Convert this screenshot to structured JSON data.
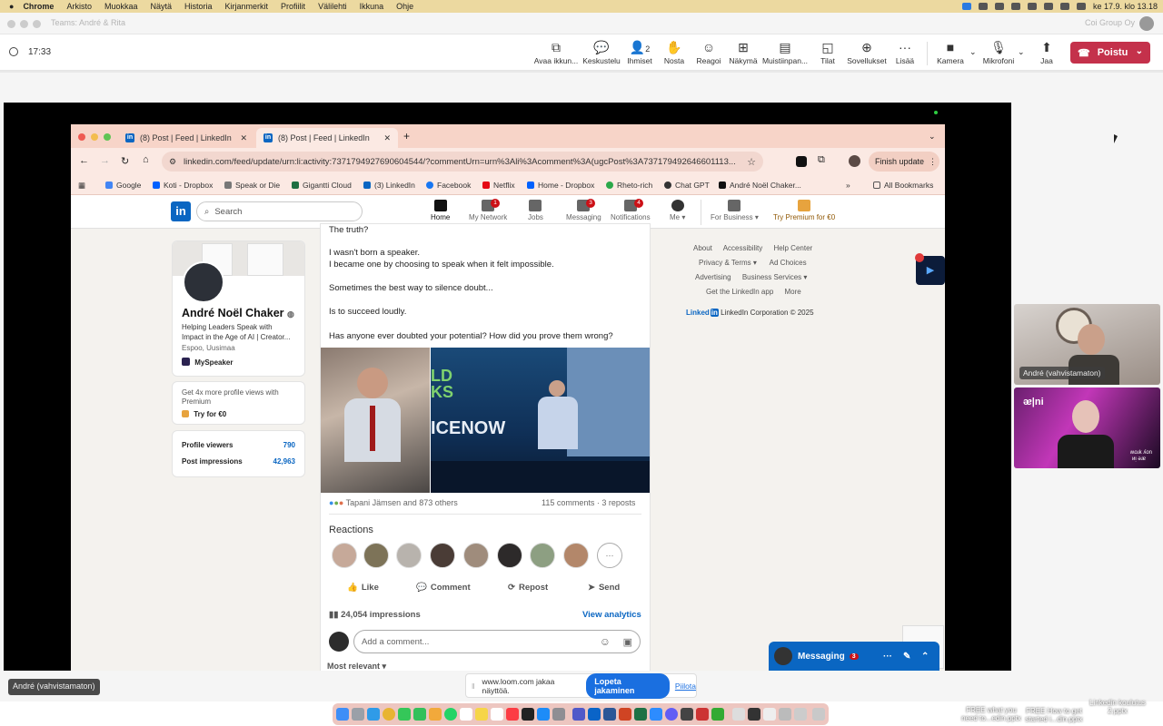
{
  "menubar": {
    "app": "Chrome",
    "items": [
      "Arkisto",
      "Muokkaa",
      "Näytä",
      "Historia",
      "Kirjanmerkit",
      "Profiilit",
      "Välilehti",
      "Ikkuna",
      "Ohje"
    ],
    "clock": "ke 17.9. klo 13.18"
  },
  "teams_title": {
    "left": "Teams: André & Rita",
    "right": "Coi Group Oy"
  },
  "meeting": {
    "timer": "17:33",
    "toolbar": [
      {
        "label": "Avaa ikkun...",
        "icon": "popout-icon"
      },
      {
        "label": "Keskustelu",
        "icon": "chat-icon"
      },
      {
        "label": "Ihmiset",
        "icon": "people-icon",
        "count": "2"
      },
      {
        "label": "Nosta",
        "icon": "raise-hand-icon"
      },
      {
        "label": "Reagoi",
        "icon": "react-icon"
      },
      {
        "label": "Näkymä",
        "icon": "view-icon"
      },
      {
        "label": "Muistiinpan...",
        "icon": "notes-icon"
      },
      {
        "label": "Tilat",
        "icon": "rooms-icon"
      },
      {
        "label": "Sovellukset",
        "icon": "apps-icon"
      },
      {
        "label": "Lisää",
        "icon": "more-icon"
      },
      {
        "label": "Kamera",
        "icon": "camera-icon"
      },
      {
        "label": "Mikrofoni",
        "icon": "mic-icon"
      },
      {
        "label": "Jaa",
        "icon": "share-icon"
      }
    ],
    "leave_label": "Poistu",
    "presenter_label": "André (vahvistamaton)"
  },
  "browser": {
    "tabs": [
      {
        "title": "(8) Post | Feed | LinkedIn",
        "active": false
      },
      {
        "title": "(8) Post | Feed | LinkedIn",
        "active": true
      }
    ],
    "url": "linkedin.com/feed/update/urn:li:activity:7371794927690604544/?commentUrn=urn%3Ali%3Acomment%3A(ugcPost%3A737179492646601113...",
    "finish_update": "Finish update",
    "bookmarks": [
      "Google",
      "Koti - Dropbox",
      "Speak or Die",
      "Gigantti Cloud",
      "(3) LinkedIn",
      "Facebook",
      "Netflix",
      "Home - Dropbox",
      "Rheto-rich",
      "Chat GPT",
      "André Noël Chaker..."
    ],
    "all_bookmarks": "All Bookmarks"
  },
  "linkedin": {
    "search_placeholder": "Search",
    "nav": [
      {
        "label": "Home",
        "badge": ""
      },
      {
        "label": "My Network",
        "badge": "1"
      },
      {
        "label": "Jobs",
        "badge": ""
      },
      {
        "label": "Messaging",
        "badge": "3"
      },
      {
        "label": "Notifications",
        "badge": "4"
      },
      {
        "label": "Me ▾",
        "badge": ""
      },
      {
        "label": "For Business ▾",
        "badge": ""
      },
      {
        "label": "Try Premium for €0",
        "badge": ""
      }
    ],
    "profile": {
      "name": "André Noël Chaker",
      "headline1": "Helping Leaders Speak with",
      "headline2": "Impact in the Age of AI | Creator...",
      "location": "Espoo, Uusimaa",
      "company": "MySpeaker",
      "premium_text1": "Get 4x more profile views with",
      "premium_text2": "Premium",
      "premium_cta": "Try for €0",
      "stats": [
        {
          "label": "Profile viewers",
          "value": "790"
        },
        {
          "label": "Post impressions",
          "value": "42,963"
        }
      ]
    },
    "post": {
      "lines": [
        "The truth?",
        "I wasn't born a speaker.",
        "I became one by choosing to speak when it felt impossible.",
        "Sometimes the best way to silence doubt...",
        "Is to succeed loudly.",
        "Has anyone ever doubted your potential? How did you prove them wrong?"
      ],
      "image_text": "ICENOW",
      "image_text_small": "LD KS",
      "reactors": "Tapani Jämsen and 873 others",
      "counts": "115 comments · 3 reposts",
      "reactions_heading": "Reactions",
      "actions": [
        "Like",
        "Comment",
        "Repost",
        "Send"
      ],
      "impressions": "24,054 impressions",
      "view_analytics": "View analytics",
      "comment_placeholder": "Add a comment...",
      "sort": "Most relevant ▾"
    },
    "footer": {
      "links_row1": [
        "About",
        "Accessibility",
        "Help Center"
      ],
      "links_row2": [
        "Privacy & Terms ▾",
        "Ad Choices"
      ],
      "links_row3": [
        "Advertising",
        "Business Services ▾"
      ],
      "links_row4": [
        "Get the LinkedIn app",
        "More"
      ],
      "brand": "Linked",
      "brand_in": "in",
      "copyright": "LinkedIn Corporation © 2025"
    },
    "messaging": {
      "label": "Messaging",
      "badge": "3"
    }
  },
  "loom": {
    "text": "www.loom.com jakaa näyttöä.",
    "stop": "Lopeta jakaminen",
    "hide": "Piilota"
  },
  "participants": [
    {
      "name": "André (vahvistamaton)"
    },
    {
      "name": "",
      "overlay_text": "ᴎᴉ ǝɹɐ",
      "overlay_text2": "ʍoɹk ʎon"
    }
  ],
  "desktop_files": [
    {
      "line1": "FREE what you",
      "line2": "need to...edin.pptx"
    },
    {
      "line1": "FREE How to get",
      "line2": "started i...din.pptx"
    },
    {
      "line1": "Linkedin koulutus",
      "line2": "2.pptx"
    }
  ],
  "colors": {
    "linkedin_blue": "#0a66c2",
    "leave_red": "#c4314b",
    "loom_blue": "#1a6fe0"
  }
}
